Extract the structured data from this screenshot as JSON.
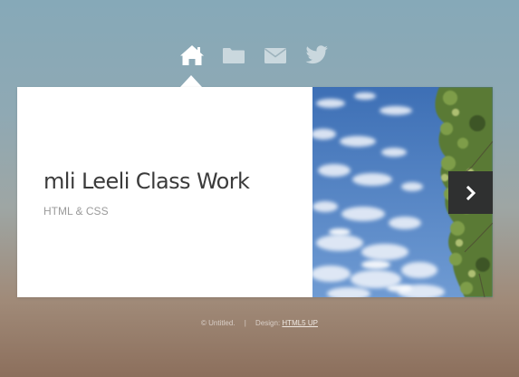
{
  "nav": {
    "items": [
      {
        "icon": "home-icon",
        "active": true
      },
      {
        "icon": "folder-icon",
        "active": false
      },
      {
        "icon": "envelope-icon",
        "active": false
      },
      {
        "icon": "twitter-icon",
        "active": false
      }
    ]
  },
  "panel": {
    "title": "mli Leeli Class Work",
    "subtitle": "HTML & CSS",
    "next_icon": "chevron-right-icon"
  },
  "footer": {
    "copyright": "© Untitled.",
    "separator": "|",
    "design_label": "Design:",
    "design_link": "HTML5 UP"
  },
  "colors": {
    "panel_bg": "#ffffff",
    "title_text": "#3b3b3b",
    "subtitle_text": "#9a9a9a",
    "next_button_bg": "#2f3030",
    "nav_icon": "#ffffff"
  }
}
